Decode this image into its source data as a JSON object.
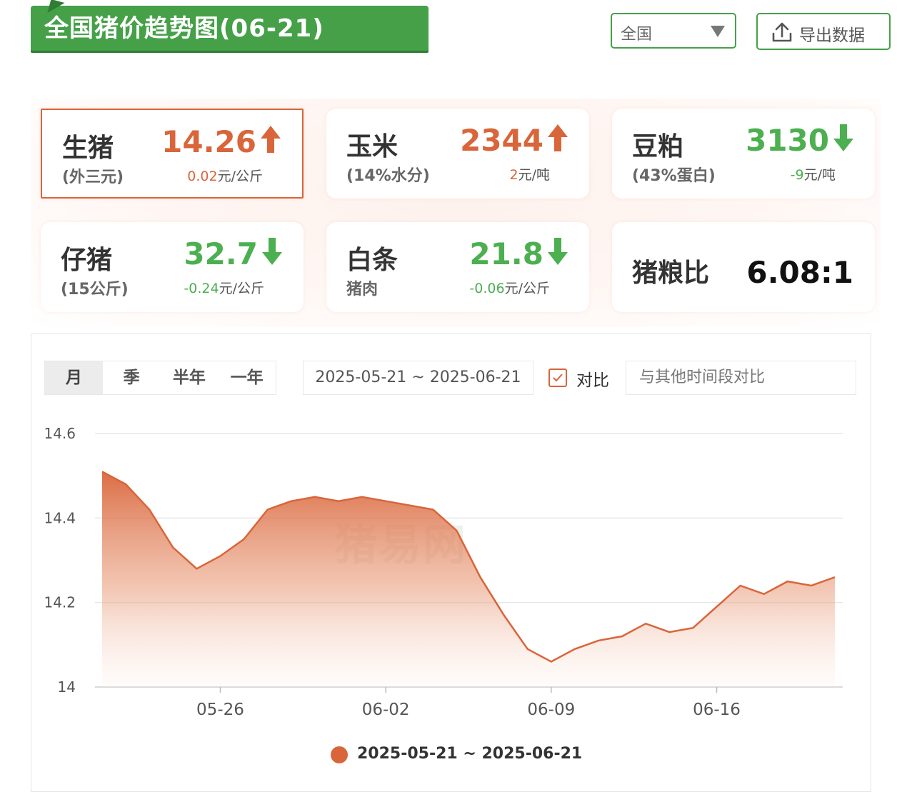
{
  "header": {
    "title": "全国猪价趋势图(06-21)",
    "region_select": "全国",
    "export_label": "导出数据"
  },
  "colors": {
    "brand_green": "#45a048",
    "up_orange": "#d9653a",
    "down_green": "#4caf50"
  },
  "cards": {
    "pig": {
      "name": "生猪",
      "sub": "(外三元)",
      "price": "14.26",
      "change": "0.02",
      "unit": "元/公斤",
      "trend": "up"
    },
    "corn": {
      "name": "玉米",
      "sub": "(14%水分)",
      "price": "2344",
      "change": "2",
      "unit": "元/吨",
      "trend": "up"
    },
    "soymeal": {
      "name": "豆粕",
      "sub": "(43%蛋白)",
      "price": "3130",
      "change": "-9",
      "unit": "元/吨",
      "trend": "down"
    },
    "piglet": {
      "name": "仔猪",
      "sub": "(15公斤)",
      "price": "32.7",
      "change": "-0.24",
      "unit": "元/公斤",
      "trend": "down"
    },
    "pork": {
      "name": "白条",
      "sub": "猪肉",
      "price": "21.8",
      "change": "-0.06",
      "unit": "元/公斤",
      "trend": "down"
    },
    "ratio": {
      "name": "猪粮比",
      "value": "6.08:1"
    }
  },
  "controls": {
    "tabs": [
      "月",
      "季",
      "半年",
      "一年"
    ],
    "active_tab": "月",
    "date_range": "2025-05-21 ~ 2025-06-21",
    "compare_label": "对比",
    "compare_checked": true,
    "compare_placeholder": "与其他时间段对比"
  },
  "watermark": "猪易网",
  "chart_data": {
    "type": "area",
    "title": "",
    "xlabel": "",
    "ylabel": "",
    "ylim": [
      14,
      14.6
    ],
    "yticks": [
      "14.6",
      "14.4",
      "14.2",
      "14"
    ],
    "xticks": [
      "05-26",
      "06-02",
      "06-09",
      "06-16"
    ],
    "x": [
      "05-21",
      "05-22",
      "05-23",
      "05-24",
      "05-25",
      "05-26",
      "05-27",
      "05-28",
      "05-29",
      "05-30",
      "05-31",
      "06-01",
      "06-02",
      "06-03",
      "06-04",
      "06-05",
      "06-06",
      "06-07",
      "06-08",
      "06-09",
      "06-10",
      "06-11",
      "06-12",
      "06-13",
      "06-14",
      "06-15",
      "06-16",
      "06-17",
      "06-18",
      "06-19",
      "06-20",
      "06-21"
    ],
    "series": [
      {
        "name": "2025-05-21 ~ 2025-06-21",
        "color": "#d9653a",
        "values": [
          14.51,
          14.48,
          14.42,
          14.33,
          14.28,
          14.31,
          14.35,
          14.42,
          14.44,
          14.45,
          14.44,
          14.45,
          14.44,
          14.43,
          14.42,
          14.37,
          14.26,
          14.17,
          14.09,
          14.06,
          14.09,
          14.11,
          14.12,
          14.15,
          14.13,
          14.14,
          14.19,
          14.24,
          14.22,
          14.25,
          14.24,
          14.26
        ]
      }
    ],
    "grid": true,
    "legend": "bottom-center"
  }
}
